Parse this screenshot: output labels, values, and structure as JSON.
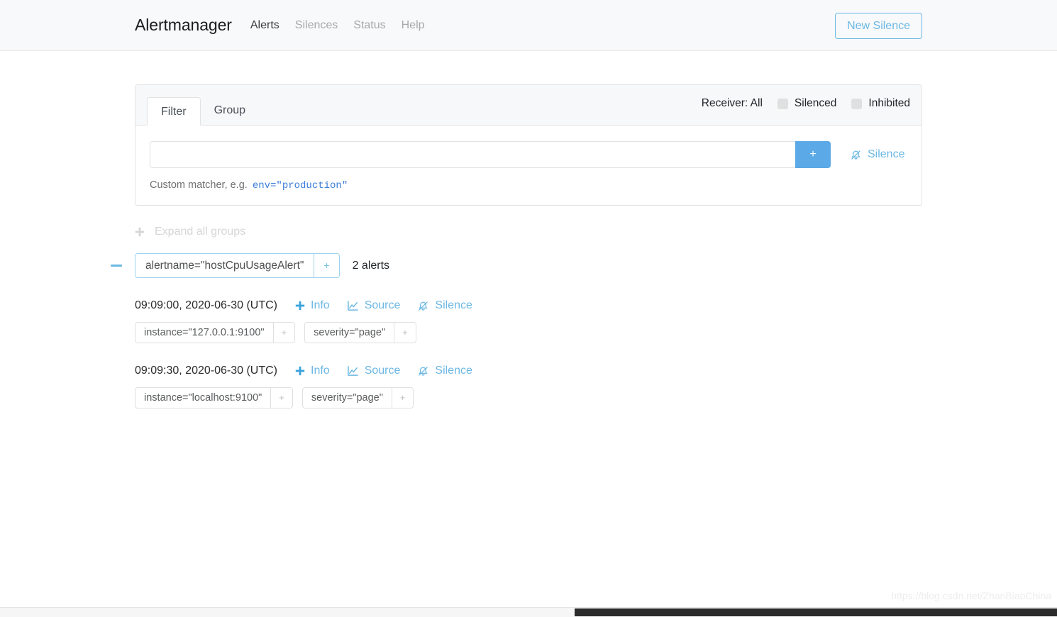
{
  "navbar": {
    "brand": "Alertmanager",
    "links": [
      {
        "label": "Alerts",
        "active": true
      },
      {
        "label": "Silences",
        "active": false
      },
      {
        "label": "Status",
        "active": false
      },
      {
        "label": "Help",
        "active": false
      }
    ],
    "new_silence_label": "New Silence"
  },
  "filter_card": {
    "tabs": [
      {
        "label": "Filter",
        "active": true
      },
      {
        "label": "Group",
        "active": false
      }
    ],
    "receiver_label": "Receiver: All",
    "toggles": [
      {
        "label": "Silenced",
        "checked": false
      },
      {
        "label": "Inhibited",
        "checked": false
      }
    ],
    "matcher_input_value": "",
    "matcher_input_placeholder": "",
    "add_button_label": "+",
    "silence_link_label": "Silence",
    "helper_text": "Custom matcher, e.g.",
    "helper_example": "env=\"production\""
  },
  "expand_all_label": "Expand all groups",
  "group": {
    "collapse_state": "expanded",
    "matcher": "alertname=\"hostCpuUsageAlert\"",
    "matcher_plus": "+",
    "alerts_count_label": "2 alerts",
    "alerts": [
      {
        "time": "09:09:00, 2020-06-30 (UTC)",
        "actions": [
          {
            "label": "Info",
            "icon": "plus-icon"
          },
          {
            "label": "Source",
            "icon": "chart-line-icon"
          },
          {
            "label": "Silence",
            "icon": "bell-slash-icon"
          }
        ],
        "labels": [
          {
            "text": "instance=\"127.0.0.1:9100\"",
            "plus": "+"
          },
          {
            "text": "severity=\"page\"",
            "plus": "+"
          }
        ]
      },
      {
        "time": "09:09:30, 2020-06-30 (UTC)",
        "actions": [
          {
            "label": "Info",
            "icon": "plus-icon"
          },
          {
            "label": "Source",
            "icon": "chart-line-icon"
          },
          {
            "label": "Silence",
            "icon": "bell-slash-icon"
          }
        ],
        "labels": [
          {
            "text": "instance=\"localhost:9100\"",
            "plus": "+"
          },
          {
            "text": "severity=\"page\"",
            "plus": "+"
          }
        ]
      }
    ]
  },
  "watermark": "https://blog.csdn.net/ZhanBiaoChina",
  "colors": {
    "accent_blue": "#6cb8e4",
    "button_blue": "#5ba9e6",
    "code_blue": "#3b7dd8",
    "navbar_bg": "#f8f9fa"
  }
}
